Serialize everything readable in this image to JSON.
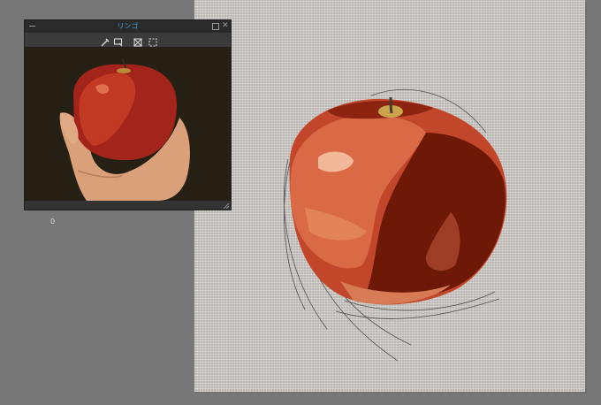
{
  "app": {
    "subview": {
      "title": "リンゴ",
      "tools": [
        {
          "icon": "eyedropper-icon"
        },
        {
          "icon": "transform-icon"
        },
        {
          "icon": "fit-view-icon"
        },
        {
          "icon": "selection-icon"
        }
      ],
      "controls": {
        "minimize_icon": "minimize-icon",
        "restore_icon": "restore-icon",
        "close_icon": "close-icon",
        "close_glyph": "✕"
      }
    },
    "stray_mark": "0"
  },
  "colors": {
    "workspace_bg": "#777777",
    "canvas_bg": "#cfcbc7",
    "title_accent": "#3aa6e8",
    "apple_light": "#e38a5e",
    "apple_mid": "#c2462a",
    "apple_dark": "#6e1808"
  }
}
